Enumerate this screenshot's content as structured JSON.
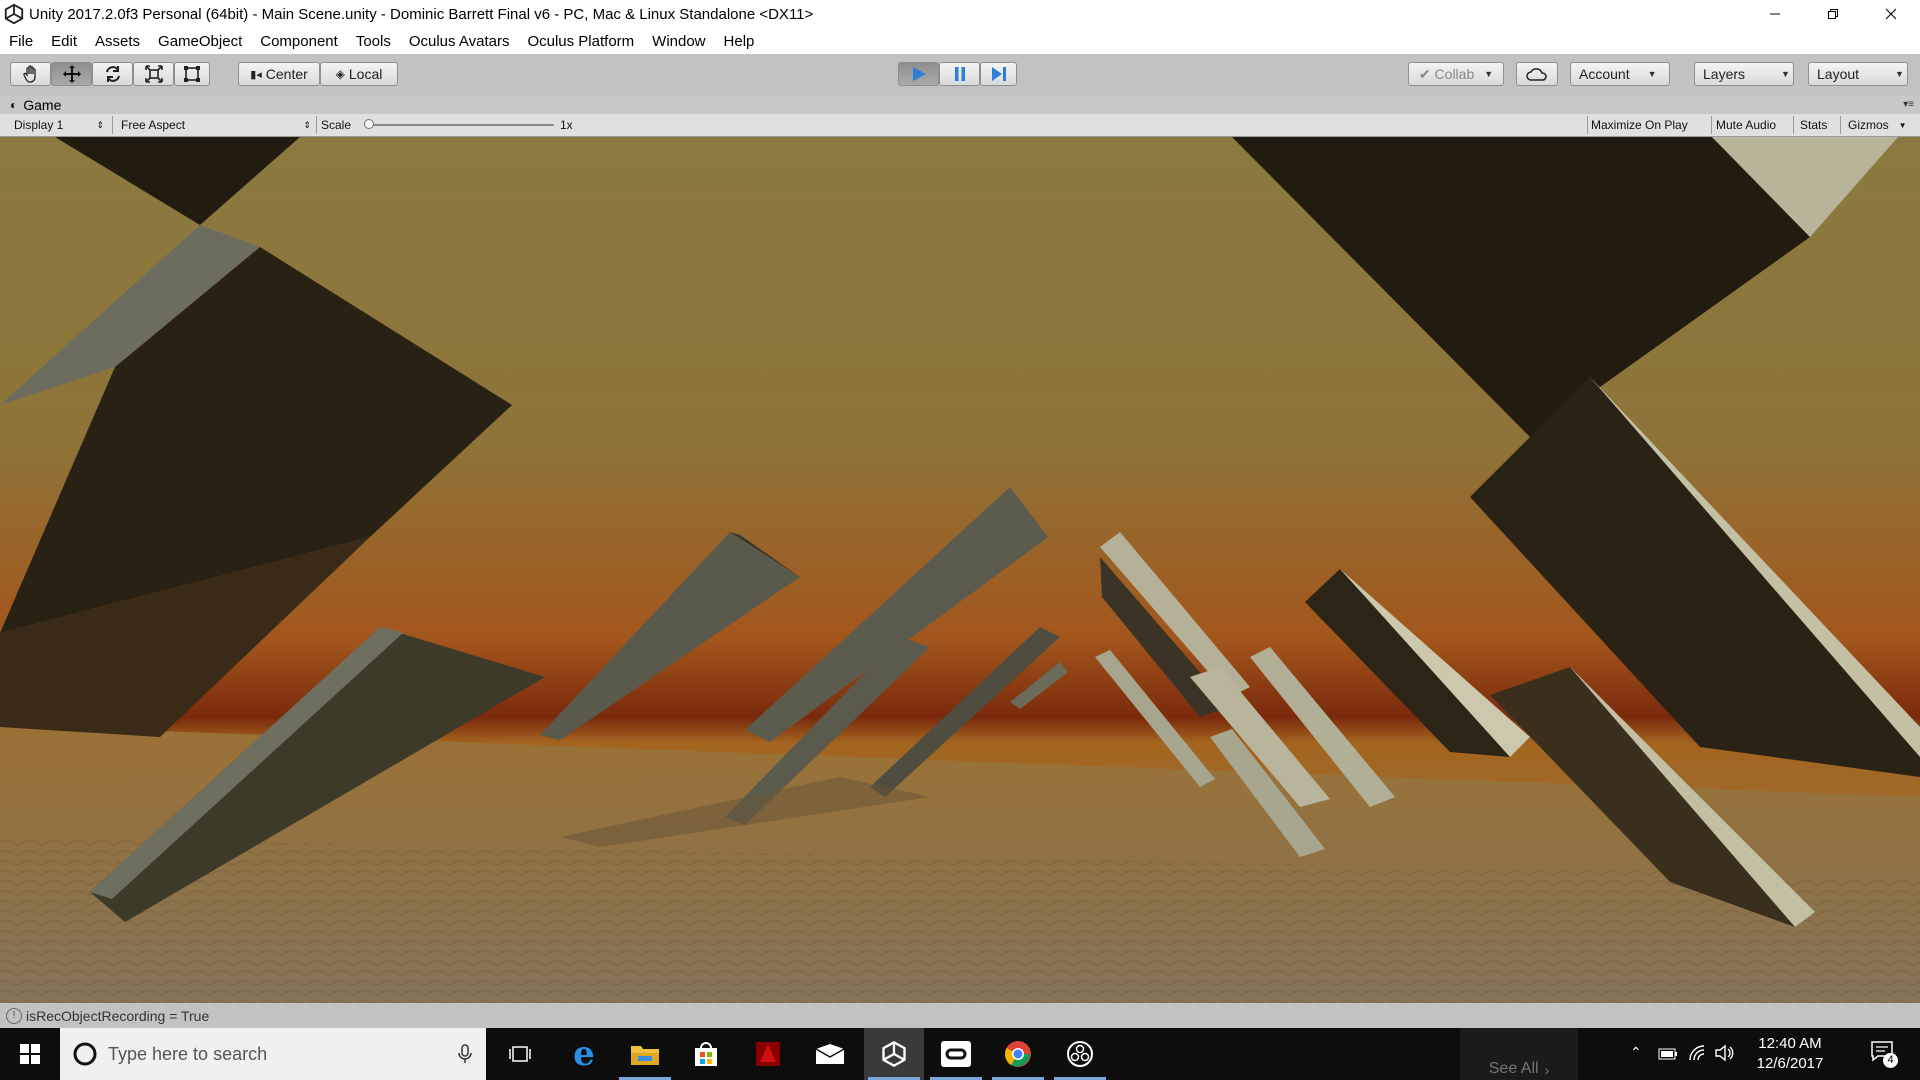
{
  "window": {
    "title": "Unity 2017.2.0f3 Personal (64bit) - Main Scene.unity - Dominic Barrett Final v6 - PC, Mac & Linux Standalone <DX11>",
    "buttons": [
      "minimize-icon",
      "restore-icon",
      "close-icon"
    ]
  },
  "menu": [
    "File",
    "Edit",
    "Assets",
    "GameObject",
    "Component",
    "Tools",
    "Oculus Avatars",
    "Oculus Platform",
    "Window",
    "Help"
  ],
  "toolbar": {
    "transform_tools": [
      "hand-icon",
      "move-icon",
      "rotate-icon",
      "scale-icon",
      "rect-icon"
    ],
    "pivot_label": "Center",
    "space_label": "Local",
    "play_icon": "play-icon",
    "pause_icon": "pause-icon",
    "step_icon": "step-icon",
    "collab_label": "Collab",
    "account_label": "Account",
    "layers_label": "Layers",
    "layout_label": "Layout"
  },
  "game_view": {
    "tab_label": "Game",
    "display_label": "Display 1",
    "aspect_label": "Free Aspect",
    "scale_label": "Scale",
    "scale_value": "1x",
    "maximize_label": "Maximize On Play",
    "mute_label": "Mute Audio",
    "stats_label": "Stats",
    "gizmos_label": "Gizmos"
  },
  "status": {
    "message": "isRecObjectRecording = True"
  },
  "taskbar": {
    "search_placeholder": "Type here to search",
    "see_all_label": "See All",
    "time": "12:40 AM",
    "date": "12/6/2017",
    "notification_count": "4",
    "pinned": [
      "task-view-icon",
      "edge-icon",
      "file-explorer-icon",
      "store-icon",
      "red-app-icon",
      "mail-icon",
      "unity-icon",
      "oculus-icon",
      "chrome-icon",
      "obs-icon"
    ]
  },
  "colors": {
    "accent_blue": "#3b82d6",
    "editor_gray": "#c2c2c2",
    "taskbar": "#0d0d0d"
  }
}
